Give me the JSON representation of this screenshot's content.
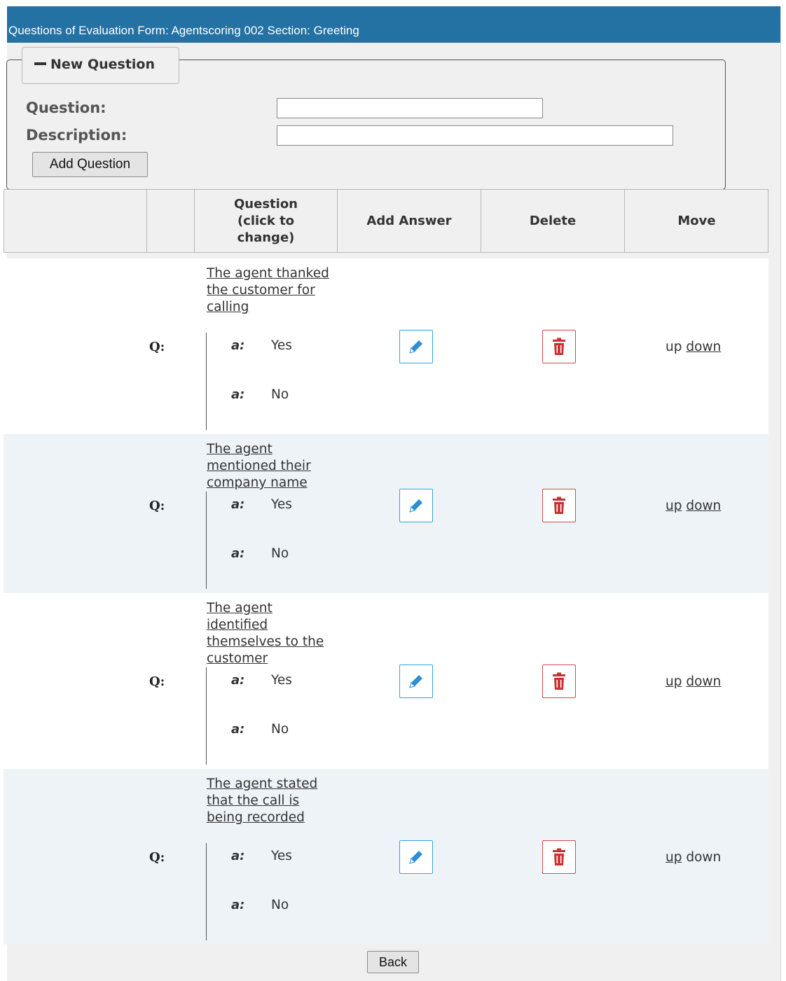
{
  "title": "Questions of Evaluation Form: Agentscoring 002 Section: Greeting",
  "new_question": {
    "legend": "New Question",
    "question_label": "Question:",
    "question_value": "",
    "description_label": "Description:",
    "description_value": "",
    "add_button": "Add Question"
  },
  "table": {
    "headers": [
      "",
      "",
      "Question (click to change)",
      "Add Answer",
      "Delete",
      "Move"
    ],
    "rows": [
      {
        "q_label": "Q:",
        "question": "The agent thanked the customer for calling",
        "answers": [
          {
            "label": "a:",
            "text": "Yes"
          },
          {
            "label": "a:",
            "text": "No"
          }
        ],
        "move_up": "up",
        "move_down": "down",
        "up_link": false,
        "down_link": true,
        "bg": "#ffffff"
      },
      {
        "q_label": "Q:",
        "question": "The agent mentioned their company name",
        "answers": [
          {
            "label": "a:",
            "text": "Yes"
          },
          {
            "label": "a:",
            "text": "No"
          }
        ],
        "move_up": "up",
        "move_down": "down",
        "up_link": true,
        "down_link": true,
        "bg": "#eef3f8"
      },
      {
        "q_label": "Q:",
        "question": "The agent identified themselves to the customer",
        "answers": [
          {
            "label": "a:",
            "text": "Yes"
          },
          {
            "label": "a:",
            "text": "No"
          }
        ],
        "move_up": "up",
        "move_down": "down",
        "up_link": true,
        "down_link": true,
        "bg": "#ffffff"
      },
      {
        "q_label": "Q:",
        "question": "The agent stated that the call is being recorded",
        "answers": [
          {
            "label": "a:",
            "text": "Yes"
          },
          {
            "label": "a:",
            "text": "No"
          }
        ],
        "move_up": "up",
        "move_down": "down",
        "up_link": true,
        "down_link": false,
        "bg": "#eef3f8"
      }
    ],
    "edit_icon": "pencil-icon",
    "delete_icon": "trash-icon"
  },
  "back_button": "Back",
  "colors": {
    "titlebar": "#2471a3",
    "panel": "#f0f0f0",
    "edit_border": "#31a3e0",
    "delete_border": "#d24a4a",
    "delete_icon": "#cc2f2f",
    "edit_icon": "#2a8fd6"
  }
}
